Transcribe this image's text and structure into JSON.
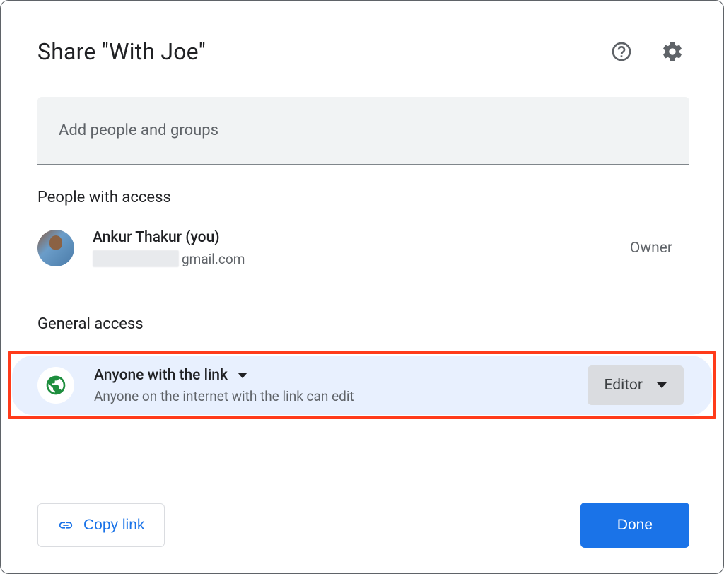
{
  "dialog": {
    "title": "Share \"With Joe\""
  },
  "search": {
    "placeholder": "Add people and groups"
  },
  "sections": {
    "people_with_access": "People with access",
    "general_access": "General access"
  },
  "people": [
    {
      "name": "Ankur Thakur (you)",
      "email_suffix": "gmail.com",
      "role": "Owner"
    }
  ],
  "general_access": {
    "scope_label": "Anyone with the link",
    "description": "Anyone on the internet with the link can edit",
    "role": "Editor"
  },
  "footer": {
    "copy_link": "Copy link",
    "done": "Done"
  },
  "icons": {
    "help": "help-icon",
    "settings": "gear-icon",
    "globe": "globe-icon",
    "link": "link-icon"
  }
}
